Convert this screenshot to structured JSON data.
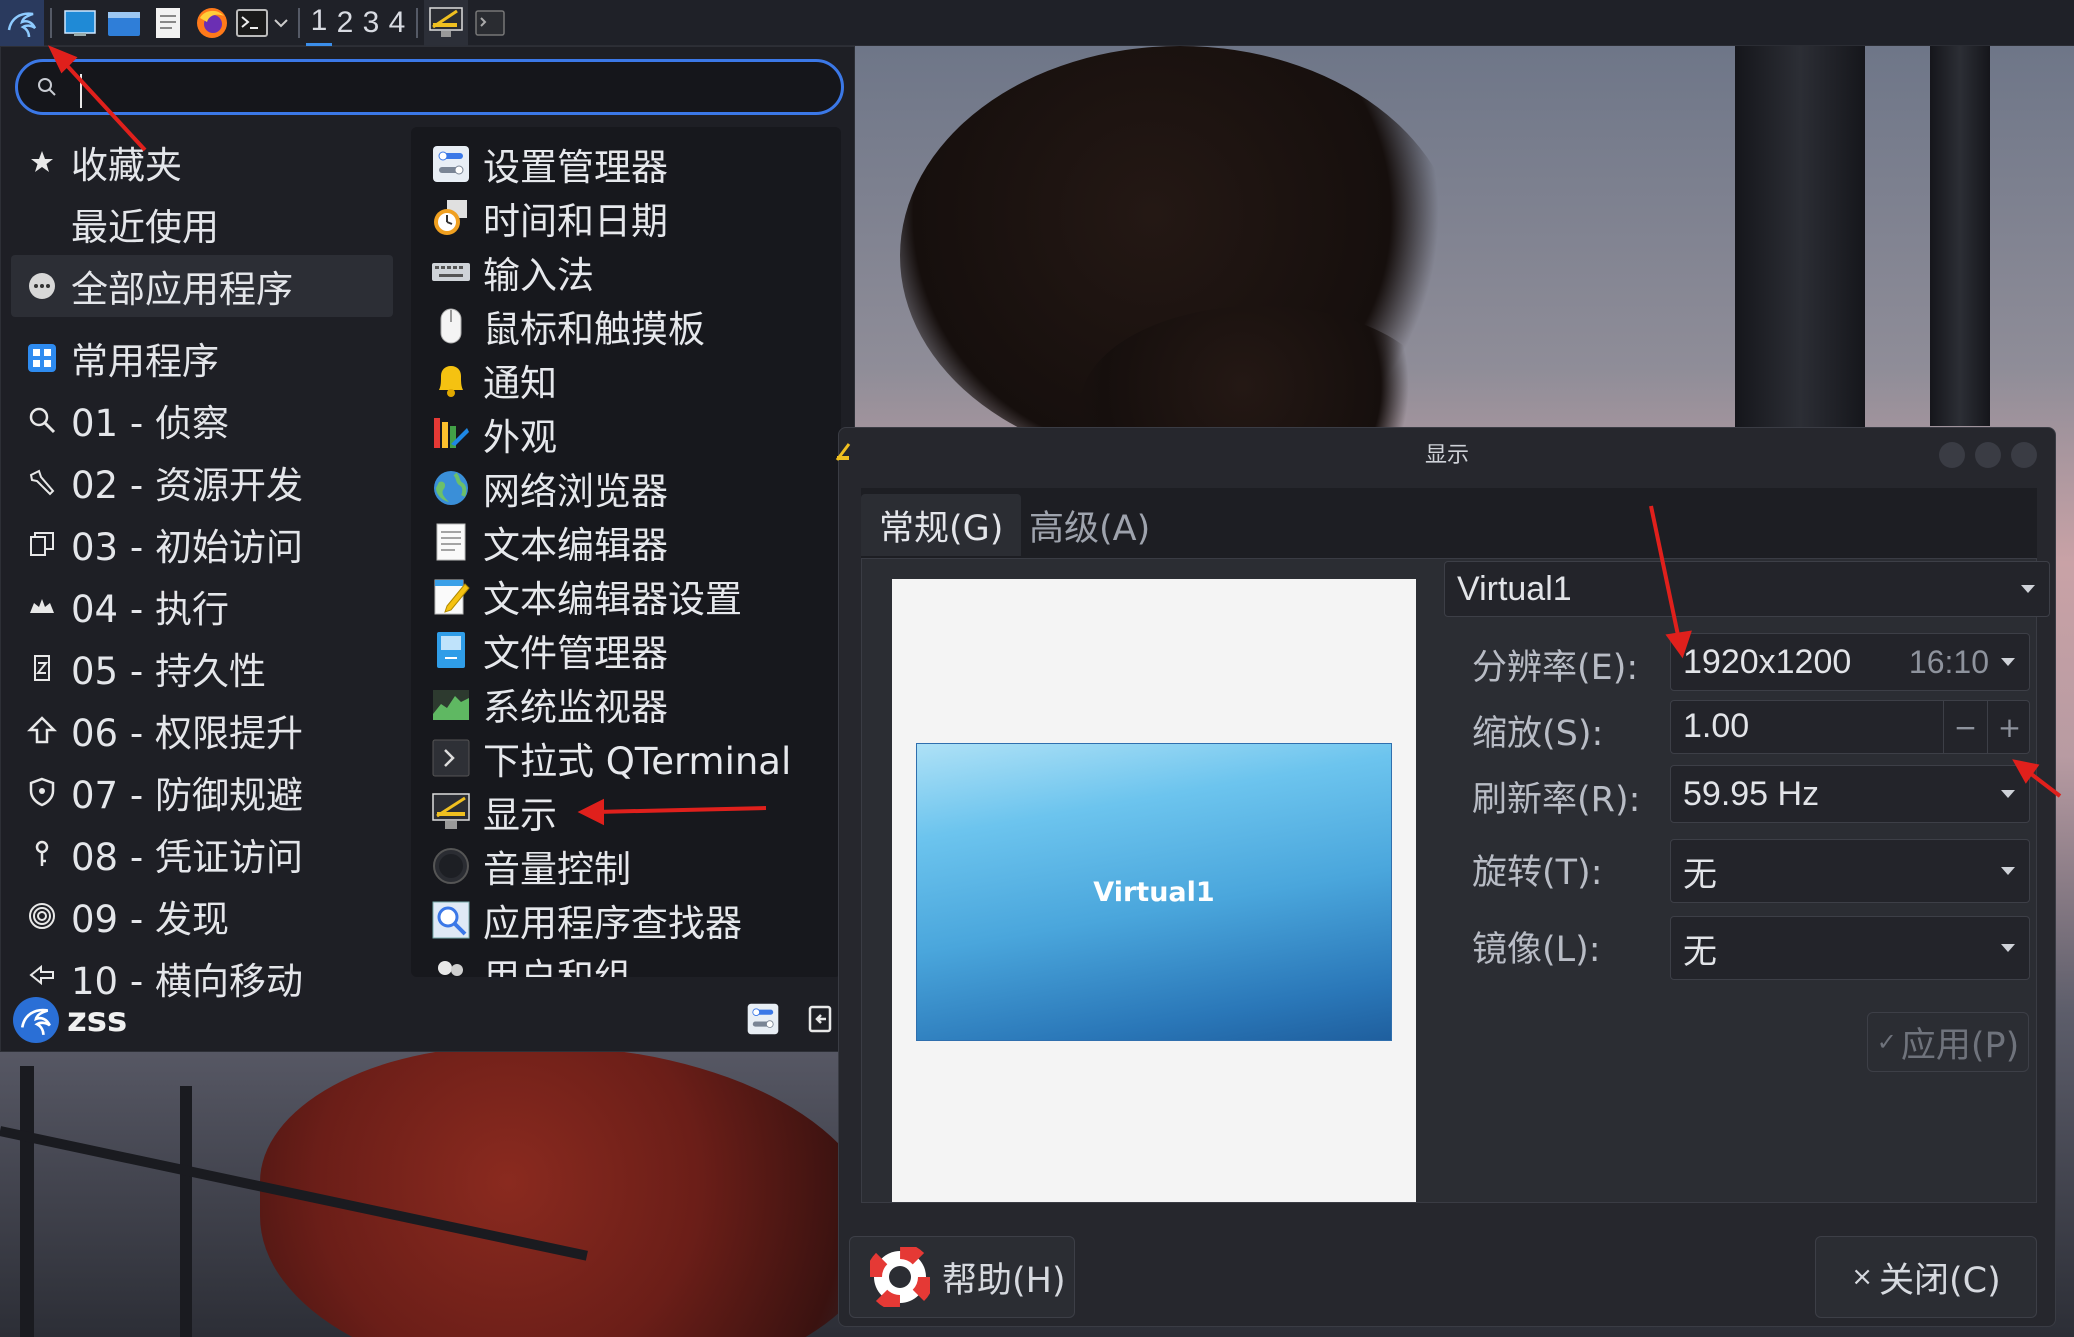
{
  "taskbar": {
    "workspaces": [
      "1",
      "2",
      "3",
      "4"
    ]
  },
  "menu": {
    "search": {
      "value": "",
      "placeholder": ""
    },
    "categories": [
      {
        "label": "收藏夹",
        "icon": "star-icon"
      },
      {
        "label": "最近使用",
        "icon": ""
      },
      {
        "label": "全部应用程序",
        "icon": "all-apps-icon"
      },
      {
        "label": "常用程序",
        "icon": "grid-icon"
      },
      {
        "label": "01 - 侦察",
        "icon": "magnifier-icon"
      },
      {
        "label": "02 - 资源开发",
        "icon": "tool-icon"
      },
      {
        "label": "03 - 初始访问",
        "icon": "door-icon"
      },
      {
        "label": "04 - 执行",
        "icon": "execute-icon"
      },
      {
        "label": "05 - 持久性",
        "icon": "persistence-icon"
      },
      {
        "label": "06 - 权限提升",
        "icon": "arrow-up-icon"
      },
      {
        "label": "07 - 防御规避",
        "icon": "shield-icon"
      },
      {
        "label": "08 - 凭证访问",
        "icon": "key-icon"
      },
      {
        "label": "09 - 发现",
        "icon": "fingerprint-icon"
      },
      {
        "label": "10 - 横向移动",
        "icon": "lateral-icon"
      }
    ],
    "apps": [
      {
        "label": "设置管理器",
        "icon": "settings-manager-icon"
      },
      {
        "label": "时间和日期",
        "icon": "clock-icon"
      },
      {
        "label": "输入法",
        "icon": "keyboard-icon"
      },
      {
        "label": "鼠标和触摸板",
        "icon": "mouse-icon"
      },
      {
        "label": "通知",
        "icon": "bell-icon"
      },
      {
        "label": "外观",
        "icon": "palette-icon"
      },
      {
        "label": "网络浏览器",
        "icon": "globe-icon"
      },
      {
        "label": "文本编辑器",
        "icon": "text-editor-icon"
      },
      {
        "label": "文本编辑器设置",
        "icon": "editor-settings-icon"
      },
      {
        "label": "文件管理器",
        "icon": "file-manager-icon"
      },
      {
        "label": "系统监视器",
        "icon": "system-monitor-icon"
      },
      {
        "label": "下拉式 QTerminal",
        "icon": "terminal-icon"
      },
      {
        "label": "显示",
        "icon": "display-icon"
      },
      {
        "label": "音量控制",
        "icon": "volume-icon"
      },
      {
        "label": "应用程序查找器",
        "icon": "app-finder-icon"
      },
      {
        "label": "用户和组",
        "icon": "users-icon"
      }
    ],
    "user": "zss"
  },
  "dialog": {
    "title": "显示",
    "tabs": [
      "常规(G)",
      "高级(A)"
    ],
    "monitor_label": "Virtual1",
    "output_select": "Virtual1",
    "resolution": {
      "label": "分辨率(E):",
      "value": "1920x1200",
      "aspect": "16:10"
    },
    "scale": {
      "label": "缩放(S):",
      "value": "1.00",
      "minus": "−",
      "plus": "+"
    },
    "refresh": {
      "label": "刷新率(R):",
      "value": "59.95 Hz"
    },
    "rotation": {
      "label": "旋转(T):",
      "value": "无"
    },
    "mirror": {
      "label": "镜像(L):",
      "value": "无"
    },
    "apply_label": "应用(P)",
    "help_label": "帮助(H)",
    "close_label": "关闭(C)"
  },
  "colors": {
    "accent": "#3b78e7",
    "annotation": "#e0201c",
    "menu_bg": "#1e1f25",
    "dialog_bg": "#26272d"
  }
}
